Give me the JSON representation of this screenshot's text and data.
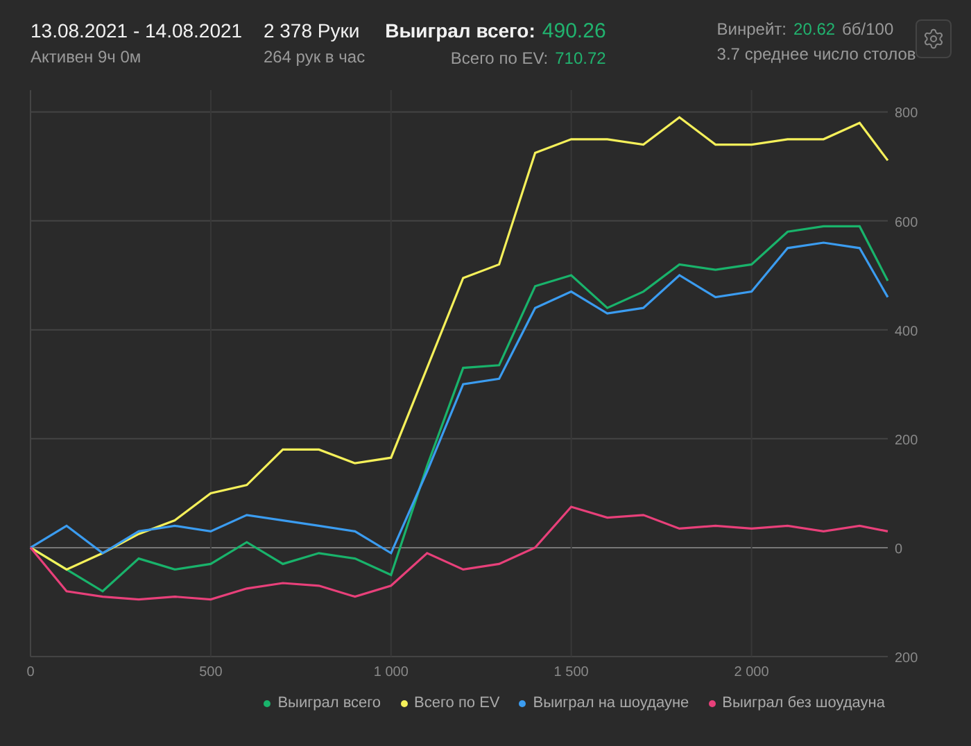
{
  "header": {
    "date_range": "13.08.2021 - 14.08.2021",
    "active_time": "Активен 9ч 0м",
    "hands": "2 378 Руки",
    "hands_per_hour": "264 рук в час",
    "won_label": "Выиграл всего:",
    "won_value": "490.26",
    "ev_label": "Всего по EV:",
    "ev_value": "710.72",
    "winrate_label": "Винрейт:",
    "winrate_value": "20.62",
    "winrate_unit": "бб/100",
    "tables": "3.7 среднее число столов"
  },
  "chart_data": {
    "type": "line",
    "x": [
      0,
      100,
      200,
      300,
      400,
      500,
      600,
      700,
      800,
      900,
      1000,
      1100,
      1200,
      1300,
      1400,
      1500,
      1600,
      1700,
      1800,
      1900,
      2000,
      2100,
      2200,
      2300,
      2378
    ],
    "grid": true,
    "xlim": [
      0,
      2378
    ],
    "ylim": [
      -200,
      840
    ],
    "xticks": [
      0,
      500,
      {
        "value": 1000,
        "label": "1 000"
      },
      {
        "value": 1500,
        "label": "1 500"
      },
      {
        "value": 2000,
        "label": "2 000"
      }
    ],
    "yticks": [
      {
        "value": -200,
        "label": "200"
      },
      0,
      200,
      400,
      600,
      800
    ],
    "series": [
      {
        "name": "Выиграл всего",
        "color": "#19b36b",
        "values": [
          0,
          -40,
          -80,
          -20,
          -40,
          -30,
          10,
          -30,
          -10,
          -20,
          -50,
          150,
          330,
          335,
          480,
          500,
          440,
          470,
          520,
          510,
          520,
          580,
          590,
          590,
          490
        ]
      },
      {
        "name": "Всего по EV",
        "color": "#f5f05a",
        "values": [
          0,
          -40,
          -10,
          25,
          50,
          100,
          115,
          180,
          180,
          155,
          165,
          330,
          495,
          520,
          725,
          750,
          750,
          740,
          790,
          740,
          740,
          750,
          750,
          780,
          711
        ]
      },
      {
        "name": "Выиграл на шоудауне",
        "color": "#3b9cf0",
        "values": [
          0,
          40,
          -10,
          30,
          40,
          30,
          60,
          50,
          40,
          30,
          -10,
          140,
          300,
          310,
          440,
          470,
          430,
          440,
          500,
          460,
          470,
          550,
          560,
          550,
          460
        ]
      },
      {
        "name": "Выиграл без шоудауна",
        "color": "#e8407a",
        "values": [
          0,
          -80,
          -90,
          -95,
          -90,
          -95,
          -75,
          -65,
          -70,
          -90,
          -70,
          -10,
          -40,
          -30,
          0,
          75,
          55,
          60,
          35,
          40,
          35,
          40,
          30,
          40,
          30
        ]
      }
    ]
  }
}
